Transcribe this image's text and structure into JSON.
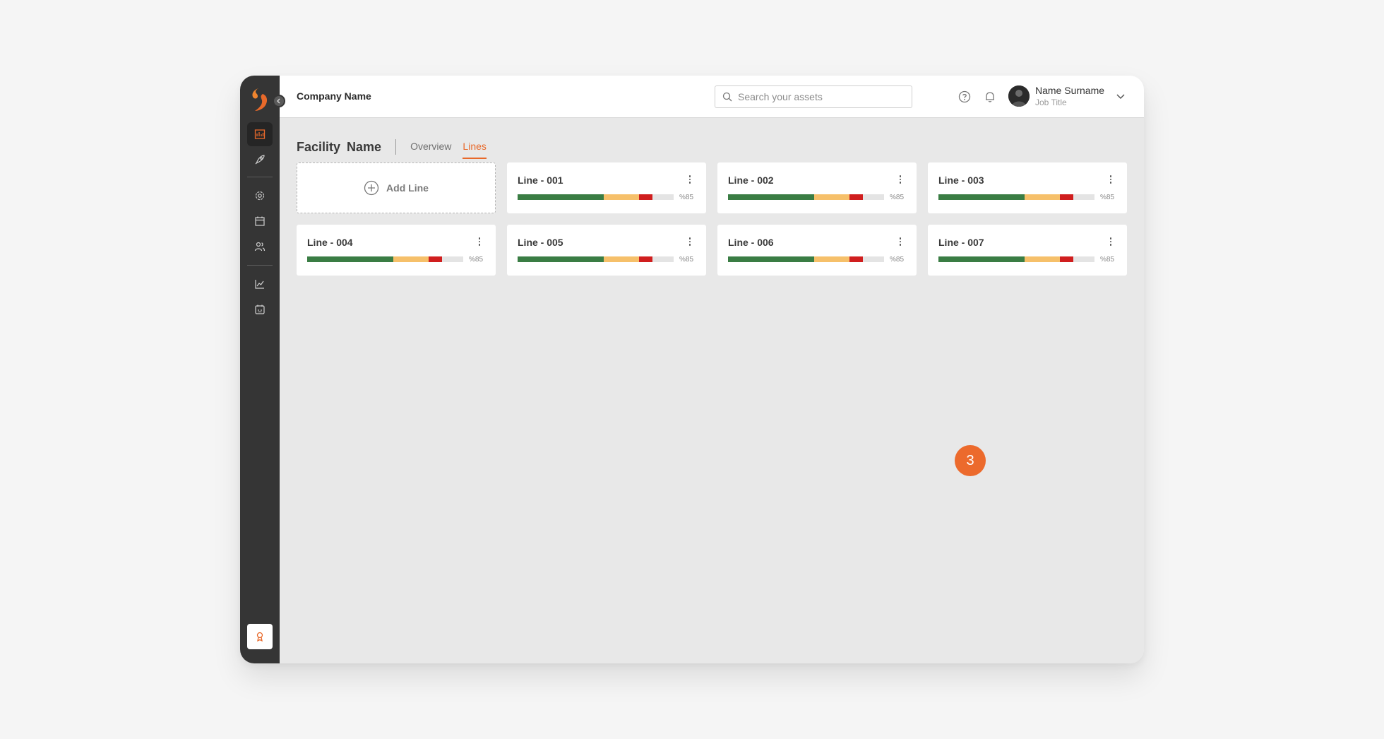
{
  "header": {
    "company_name": "Company Name",
    "search_placeholder": "Search your assets",
    "user": {
      "name": "Name Surname",
      "title": "Job Title"
    }
  },
  "page": {
    "facility_name": "Facility Name",
    "tabs": [
      {
        "label": "Overview",
        "active": false
      },
      {
        "label": "Lines",
        "active": true
      }
    ]
  },
  "add_line_label": "Add Line",
  "lines": [
    {
      "name": "Line - 001",
      "percent_label": "%85"
    },
    {
      "name": "Line - 002",
      "percent_label": "%85"
    },
    {
      "name": "Line - 003",
      "percent_label": "%85"
    },
    {
      "name": "Line - 004",
      "percent_label": "%85"
    },
    {
      "name": "Line - 005",
      "percent_label": "%85"
    },
    {
      "name": "Line - 006",
      "percent_label": "%85"
    },
    {
      "name": "Line - 007",
      "percent_label": "%85"
    }
  ],
  "status_bar": {
    "segments": [
      {
        "status": "good",
        "fraction": 0.55,
        "color": "#3a7d44"
      },
      {
        "status": "warning",
        "fraction": 0.23,
        "color": "#f6c06a"
      },
      {
        "status": "critical",
        "fraction": 0.085,
        "color": "#d01e1e"
      }
    ],
    "track_color": "#e4e4e4"
  },
  "step_badge": "3",
  "colors": {
    "accent": "#e8692a",
    "sidebar": "#353535"
  },
  "icons": {
    "sidebar": [
      "factory-icon",
      "rocket-icon",
      "settings-gear-icon",
      "calendar-icon",
      "users-icon",
      "chart-icon",
      "schedule-icon",
      "award-icon"
    ]
  }
}
